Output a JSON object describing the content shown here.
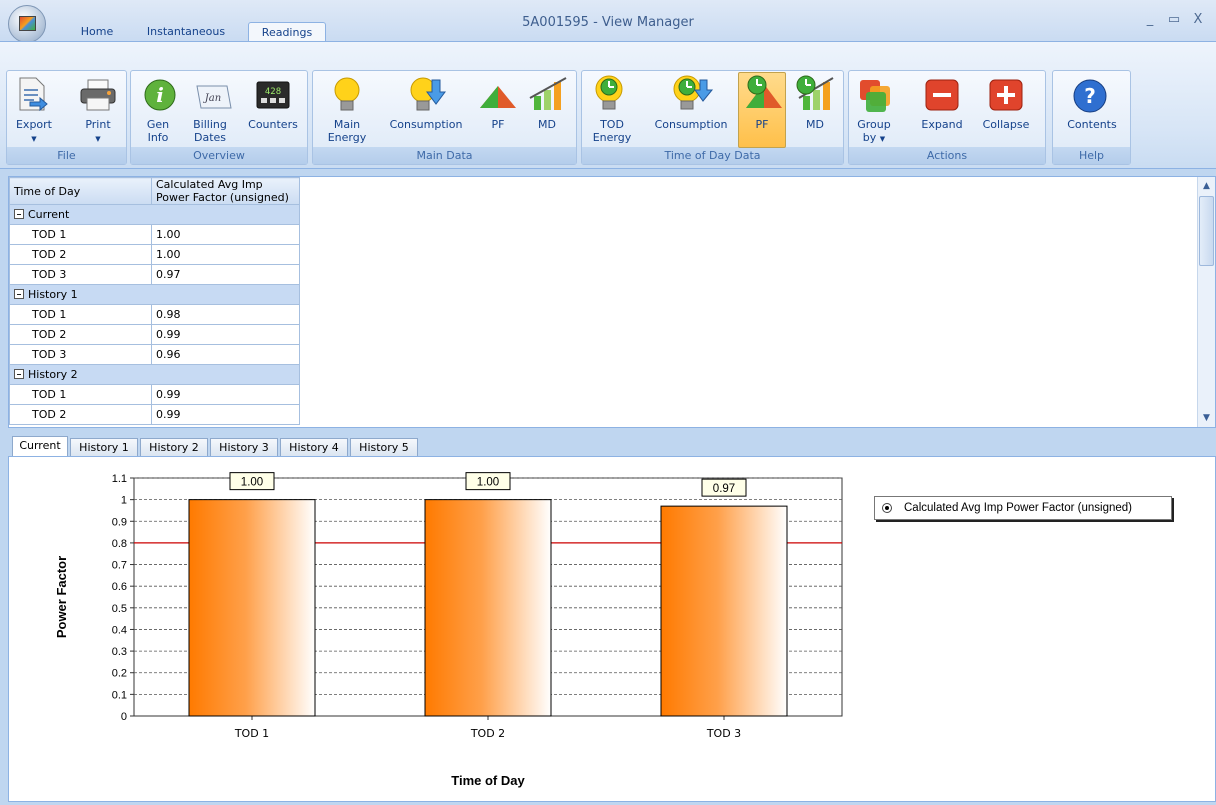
{
  "window": {
    "title": "5A001595 - View Manager",
    "minimize": "_",
    "restore": "▭",
    "close": "X"
  },
  "tabs": {
    "home": "Home",
    "instantaneous": "Instantaneous",
    "readings": "Readings"
  },
  "ribbon": {
    "file": {
      "label": "File",
      "export": "Export",
      "print": "Print"
    },
    "overview": {
      "label": "Overview",
      "gen_info_1": "Gen",
      "gen_info_2": "Info",
      "billing_1": "Billing",
      "billing_2": "Dates",
      "billing_icon_text": "Jan",
      "counters": "Counters",
      "counters_icon_text": "428"
    },
    "main_data": {
      "label": "Main Data",
      "main_energy_1": "Main",
      "main_energy_2": "Energy",
      "consumption": "Consumption",
      "pf": "PF",
      "md": "MD"
    },
    "tod_data": {
      "label": "Time of Day Data",
      "tod_energy_1": "TOD",
      "tod_energy_2": "Energy",
      "consumption": "Consumption",
      "pf": "PF",
      "md": "MD"
    },
    "actions": {
      "label": "Actions",
      "group_by_1": "Group",
      "group_by_2": "by",
      "expand": "Expand",
      "collapse": "Collapse"
    },
    "help": {
      "label": "Help",
      "contents": "Contents",
      "contents_icon_text": "?"
    }
  },
  "grid": {
    "col1": "Time of Day",
    "col2_line1": "Calculated Avg Imp",
    "col2_line2": "Power Factor (unsigned)",
    "groups": [
      {
        "name": "Current",
        "rows": [
          {
            "tod": "TOD 1",
            "value": "1.00"
          },
          {
            "tod": "TOD 2",
            "value": "1.00"
          },
          {
            "tod": "TOD 3",
            "value": "0.97"
          }
        ]
      },
      {
        "name": "History 1",
        "rows": [
          {
            "tod": "TOD 1",
            "value": "0.98"
          },
          {
            "tod": "TOD 2",
            "value": "0.99"
          },
          {
            "tod": "TOD 3",
            "value": "0.96"
          }
        ]
      },
      {
        "name": "History 2",
        "rows": [
          {
            "tod": "TOD 1",
            "value": "0.99"
          },
          {
            "tod": "TOD 2",
            "value": "0.99"
          }
        ]
      }
    ]
  },
  "chart_tabs": [
    "Current",
    "History 1",
    "History 2",
    "History 3",
    "History 4",
    "History 5"
  ],
  "chart_data": {
    "type": "bar",
    "categories": [
      "TOD 1",
      "TOD 2",
      "TOD 3"
    ],
    "values": [
      1.0,
      1.0,
      0.97
    ],
    "data_labels": [
      "1.00",
      "1.00",
      "0.97"
    ],
    "xlabel": "Time of Day",
    "ylabel": "Power Factor",
    "ylim": [
      0,
      1.1
    ],
    "yticks": [
      "0",
      "0.1",
      "0.2",
      "0.3",
      "0.4",
      "0.5",
      "0.6",
      "0.7",
      "0.8",
      "0.9",
      "1",
      "1.1"
    ],
    "threshold": 0.8,
    "threshold_color": "#cc0000",
    "bar_color": "#ff8000",
    "legend": "Calculated Avg Imp Power Factor (unsigned)",
    "legend_position": "top-right",
    "grid": true
  }
}
